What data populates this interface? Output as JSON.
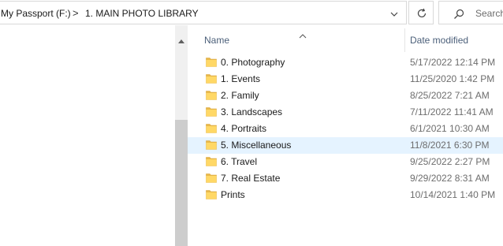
{
  "address": {
    "crumbs": [
      "My Passport (F:)",
      "1. MAIN PHOTO LIBRARY"
    ],
    "separator": ">"
  },
  "search": {
    "placeholder": "Search"
  },
  "columns": {
    "name": "Name",
    "date_modified": "Date modified"
  },
  "files": [
    {
      "name": "0. Photography",
      "date": "5/17/2022 12:14 PM",
      "selected": false
    },
    {
      "name": "1. Events",
      "date": "11/25/2020 1:42 PM",
      "selected": false
    },
    {
      "name": "2. Family",
      "date": "8/25/2022 7:21 AM",
      "selected": false
    },
    {
      "name": "3. Landscapes",
      "date": "7/11/2022 11:41 AM",
      "selected": false
    },
    {
      "name": "4. Portraits",
      "date": "6/1/2021 10:30 AM",
      "selected": false
    },
    {
      "name": "5. Miscellaneous",
      "date": "11/8/2021 6:30 PM",
      "selected": true
    },
    {
      "name": "6. Travel",
      "date": "9/25/2022 2:27 PM",
      "selected": false
    },
    {
      "name": "7. Real Estate",
      "date": "9/29/2022 8:31 AM",
      "selected": false
    },
    {
      "name": "Prints",
      "date": "10/14/2021 1:40 PM",
      "selected": false
    }
  ],
  "icons": {
    "folder": "folder-icon",
    "refresh": "refresh-icon",
    "search": "search-icon",
    "dropdown": "chevron-down-icon",
    "sort": "sort-up-icon"
  },
  "colors": {
    "selected_row": "#e5f3ff",
    "folder_fill": "#ffd866",
    "header_text": "#4c607a"
  }
}
